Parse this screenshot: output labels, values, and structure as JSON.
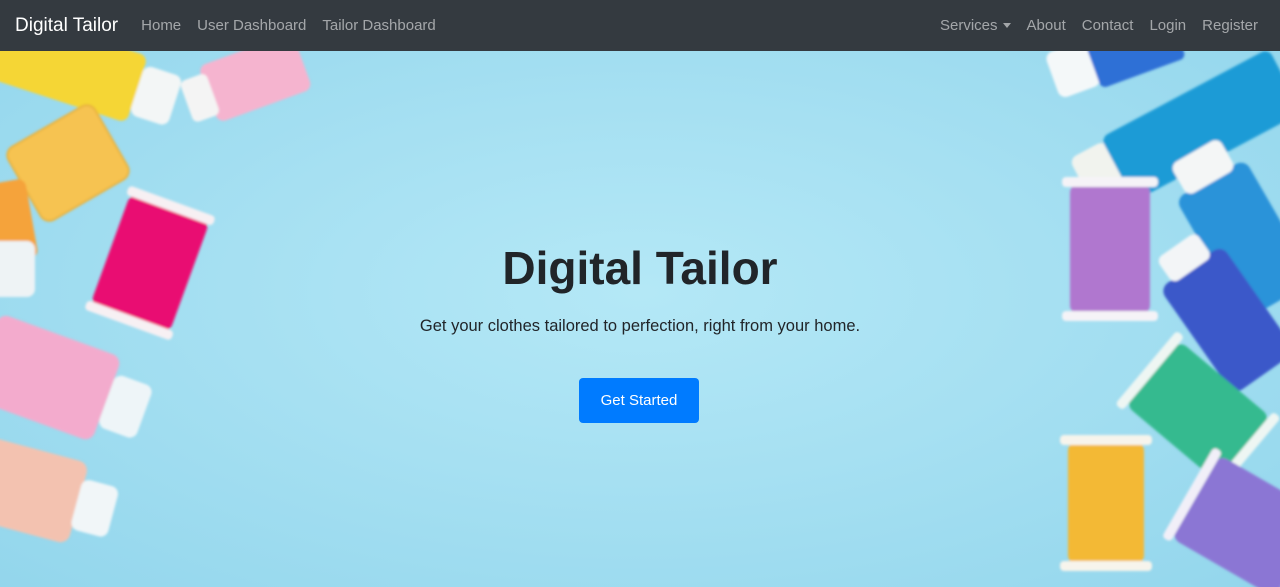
{
  "navbar": {
    "brand": "Digital Tailor",
    "left_links": [
      {
        "label": "Home"
      },
      {
        "label": "User Dashboard"
      },
      {
        "label": "Tailor Dashboard"
      }
    ],
    "services": {
      "label": "Services",
      "icon": "caret-down-icon"
    },
    "right_links": [
      {
        "label": "About"
      },
      {
        "label": "Contact"
      },
      {
        "label": "Login"
      },
      {
        "label": "Register"
      }
    ],
    "background": "#343a40"
  },
  "hero": {
    "title": "Digital Tailor",
    "subtitle": "Get your clothes tailored to perfection, right from your home.",
    "cta_label": "Get Started",
    "cta_color": "#007bff",
    "background_image": "thread-spools"
  }
}
